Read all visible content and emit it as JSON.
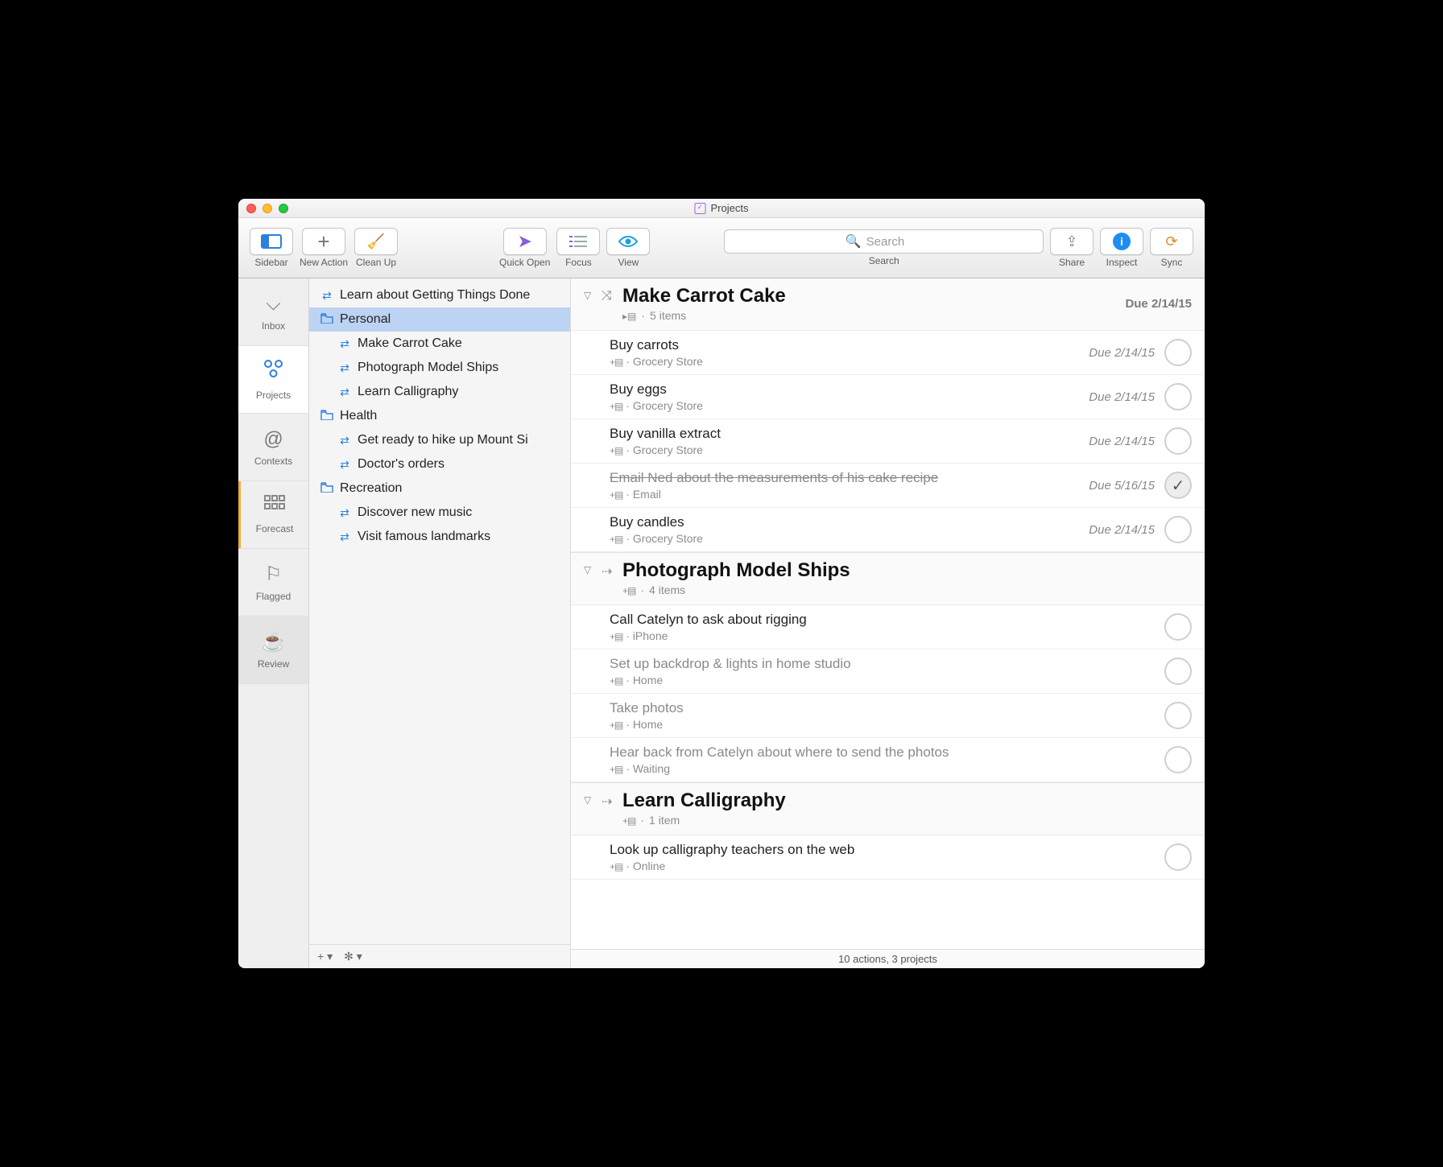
{
  "window": {
    "title": "Projects"
  },
  "toolbar": {
    "sidebar": {
      "label": "Sidebar"
    },
    "newaction": {
      "label": "New Action"
    },
    "cleanup": {
      "label": "Clean Up"
    },
    "quickopen": {
      "label": "Quick Open"
    },
    "focus": {
      "label": "Focus"
    },
    "view": {
      "label": "View"
    },
    "search": {
      "label": "Search",
      "placeholder": "Search"
    },
    "share": {
      "label": "Share"
    },
    "inspect": {
      "label": "Inspect"
    },
    "sync": {
      "label": "Sync"
    }
  },
  "perspectives": {
    "inbox": {
      "label": "Inbox"
    },
    "projects": {
      "label": "Projects"
    },
    "contexts": {
      "label": "Contexts"
    },
    "forecast": {
      "label": "Forecast"
    },
    "flagged": {
      "label": "Flagged"
    },
    "review": {
      "label": "Review"
    }
  },
  "outline": [
    {
      "type": "single",
      "title": "Learn about Getting Things Done"
    },
    {
      "type": "folder",
      "title": "Personal",
      "selected": true
    },
    {
      "type": "project",
      "title": "Make Carrot Cake"
    },
    {
      "type": "project",
      "title": "Photograph Model Ships"
    },
    {
      "type": "project",
      "title": "Learn Calligraphy"
    },
    {
      "type": "folder",
      "title": "Health"
    },
    {
      "type": "project",
      "title": "Get ready to hike up Mount Si"
    },
    {
      "type": "project",
      "title": "Doctor's orders"
    },
    {
      "type": "folder",
      "title": "Recreation"
    },
    {
      "type": "project",
      "title": "Discover new music"
    },
    {
      "type": "project",
      "title": "Visit famous landmarks"
    }
  ],
  "sections": [
    {
      "title": "Make Carrot Cake",
      "items_label": "5 items",
      "due": "Due 2/14/15",
      "project_type": "parallel",
      "tasks": [
        {
          "name": "Buy carrots",
          "context": "Grocery Store",
          "due": "Due 2/14/15"
        },
        {
          "name": "Buy eggs",
          "context": "Grocery Store",
          "due": "Due 2/14/15"
        },
        {
          "name": "Buy vanilla extract",
          "context": "Grocery Store",
          "due": "Due 2/14/15"
        },
        {
          "name": "Email Ned about the measurements of his cake recipe",
          "context": "Email",
          "due": "Due 5/16/15",
          "done": true
        },
        {
          "name": "Buy candles",
          "context": "Grocery Store",
          "due": "Due 2/14/15"
        }
      ]
    },
    {
      "title": "Photograph Model Ships",
      "items_label": "4 items",
      "project_type": "sequential",
      "tasks": [
        {
          "name": "Call Catelyn to ask about rigging",
          "context": "iPhone"
        },
        {
          "name": "Set up backdrop & lights in home studio",
          "context": "Home",
          "blocked": true
        },
        {
          "name": "Take photos",
          "context": "Home",
          "blocked": true
        },
        {
          "name": "Hear back from Catelyn about where to send the photos",
          "context": "Waiting",
          "blocked": true
        }
      ]
    },
    {
      "title": "Learn Calligraphy",
      "items_label": "1 item",
      "project_type": "sequential",
      "tasks": [
        {
          "name": "Look up calligraphy teachers on the web",
          "context": "Online"
        }
      ]
    }
  ],
  "statusbar": "10 actions, 3 projects"
}
